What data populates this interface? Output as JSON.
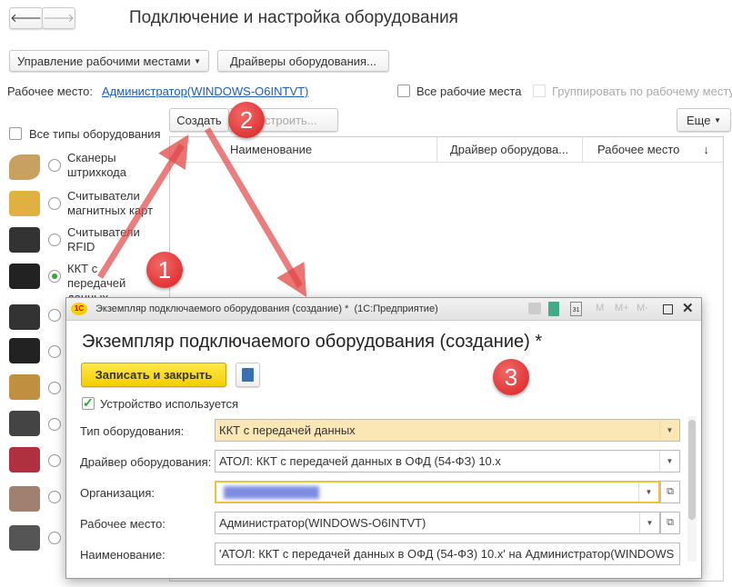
{
  "header": {
    "title": "Подключение и настройка оборудования",
    "back": "🡐",
    "forward": "🡒"
  },
  "toolbar": {
    "workplaces": "Управление рабочими местами",
    "drivers": "Драйверы оборудования..."
  },
  "workplace": {
    "label": "Рабочее место:",
    "value": "Администратор(WINDOWS-O6INTVT)",
    "all": "Все рабочие места",
    "group": "Группировать по рабочему месту"
  },
  "actions": {
    "create": "Создать",
    "configure": "Настроить...",
    "more": "Еще"
  },
  "sidebar": {
    "all_types": "Все типы оборудования",
    "items": [
      {
        "label": "Сканеры штрихкода",
        "color": "#c8a060"
      },
      {
        "label": "Считыватели магнитных карт",
        "color": "#e0b040"
      },
      {
        "label": "Считыватели RFID",
        "color": "#333333"
      },
      {
        "label": "ККТ с передачей данных",
        "color": "#222222",
        "selected": true
      }
    ],
    "more_icons": [
      "#333333",
      "#222222",
      "#c09040",
      "#444444",
      "#b03040",
      "#a08070",
      "#555555"
    ]
  },
  "table": {
    "columns": [
      "Наименование",
      "Драйвер оборудова...",
      "Рабочее место"
    ],
    "sort": "↓"
  },
  "dialog": {
    "window_title": "Экземпляр подключаемого оборудования (создание) *  (1С:Предприятие)",
    "logo": "1С",
    "tools": [
      "M",
      "M+",
      "M-"
    ],
    "heading": "Экземпляр подключаемого оборудования (создание) *",
    "save_close": "Записать и закрыть",
    "in_use": "Устройство используется",
    "fields": [
      {
        "label": "Тип оборудования:",
        "value": "ККТ с передачей данных"
      },
      {
        "label": "Драйвер оборудования:",
        "value": "АТОЛ: ККТ с передачей данных в ОФД (54-ФЗ) 10.x"
      },
      {
        "label": "Организация:",
        "value": ""
      },
      {
        "label": "Рабочее место:",
        "value": "Администратор(WINDOWS-O6INTVT)"
      },
      {
        "label": "Наименование:",
        "value": "'АТОЛ: ККТ с передачей данных в ОФД (54-ФЗ) 10.x' на Администратор(WINDOWS"
      }
    ]
  },
  "badges": [
    "1",
    "2",
    "3"
  ]
}
